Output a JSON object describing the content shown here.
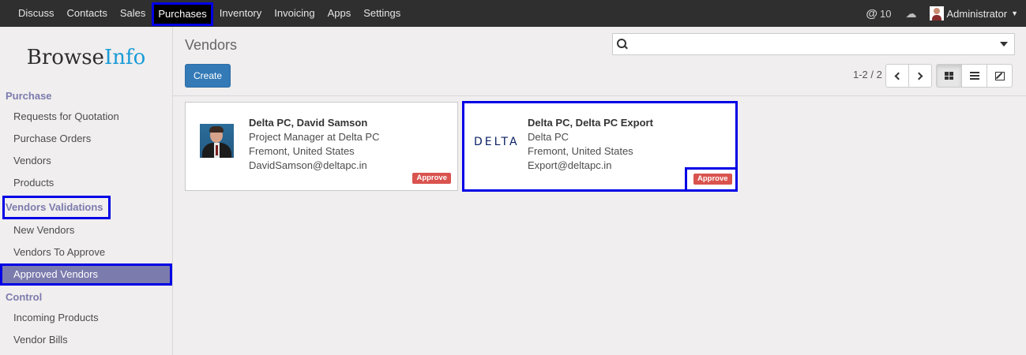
{
  "topbar": {
    "menu": [
      "Discuss",
      "Contacts",
      "Sales",
      "Purchases",
      "Inventory",
      "Invoicing",
      "Apps",
      "Settings"
    ],
    "active_menu": "Purchases",
    "notification_count": "10",
    "user_name": "Administrator"
  },
  "sidebar": {
    "brand_part1": "Browse",
    "brand_part2": "Info",
    "sections": [
      {
        "title": "Purchase",
        "items": [
          "Requests for Quotation",
          "Purchase Orders",
          "Vendors",
          "Products"
        ]
      },
      {
        "title": "Vendors Validations",
        "items": [
          "New Vendors",
          "Vendors To Approve",
          "Approved Vendors"
        ]
      },
      {
        "title": "Control",
        "items": [
          "Incoming Products",
          "Vendor Bills"
        ]
      }
    ],
    "active_item": "Approved Vendors"
  },
  "control_panel": {
    "breadcrumb": "Vendors",
    "search_placeholder": "",
    "create_label": "Create",
    "pager": "1-2 / 2"
  },
  "cards": [
    {
      "name": "Delta PC, David Samson",
      "line2": "Project Manager at Delta PC",
      "line3": "Fremont, United States",
      "line4": "DavidSamson@deltapc.in",
      "badge": "Approve",
      "image": "person-photo"
    },
    {
      "name": "Delta PC, Delta PC Export",
      "line2": "Delta PC",
      "line3": "Fremont, United States",
      "line4": "Export@deltapc.in",
      "badge": "Approve",
      "logo_text": "DELTA"
    }
  ],
  "colors": {
    "accent": "#7c7bad",
    "primary": "#337ab7",
    "badge": "#d9534f",
    "highlight": "#0000e6"
  }
}
